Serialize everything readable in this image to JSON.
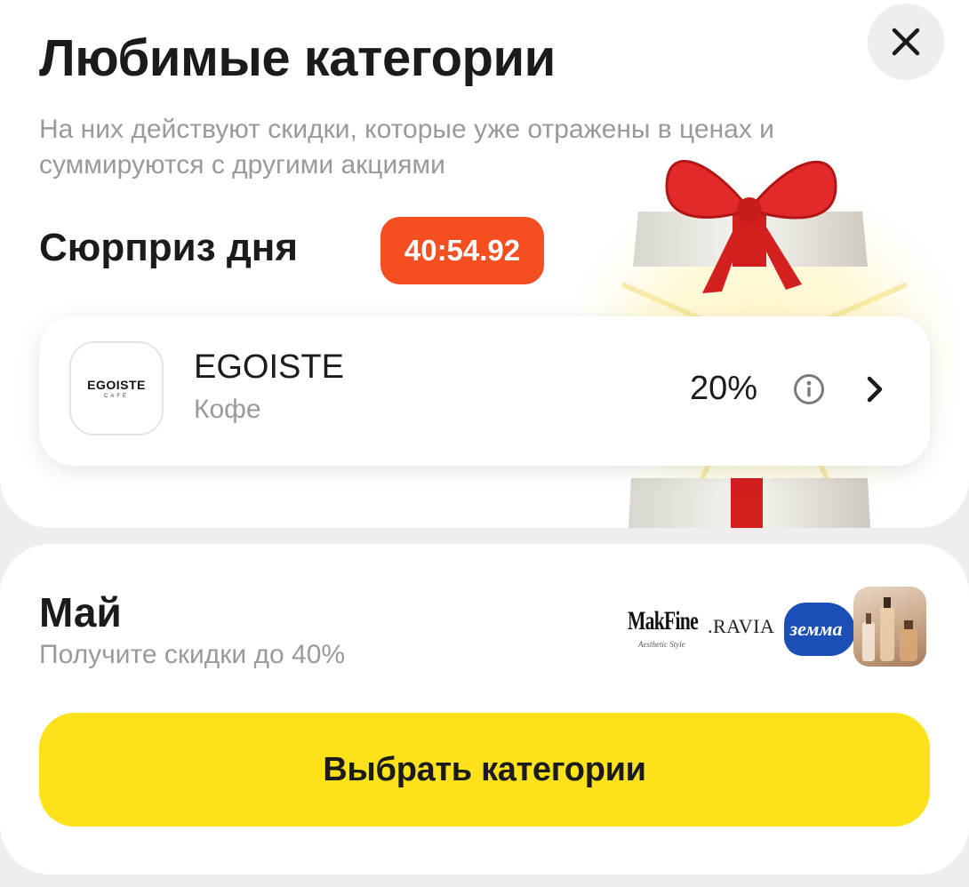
{
  "header": {
    "title": "Любимые категории",
    "subtitle": "На них действуют скидки, которые уже отражены в ценах и суммируются с другими акциями",
    "close_icon": "close-icon"
  },
  "surprise": {
    "title": "Сюрприз дня",
    "timer": "40:54.92",
    "illustration": "gift-box-with-red-bow",
    "colors": {
      "timer": "#f54e21",
      "bow": "#d41f1f"
    }
  },
  "brand_card": {
    "logo_text": "EGOISTE",
    "logo_subtext": "CAFÉ",
    "name": "EGOISTE",
    "category": "Кофе",
    "discount": "20%",
    "info_icon": "info-icon",
    "chevron_icon": "chevron-right-icon"
  },
  "month": {
    "title": "Май",
    "subtitle": "Получите скидки до 40%",
    "brand_logos": [
      {
        "text": "MakFine",
        "caption": "Aesthetic Style"
      },
      {
        "text": ".RAVIA"
      },
      {
        "text": "земма",
        "color": "#1a4fb6"
      },
      {
        "text": "",
        "image": "cosmetics-bottles"
      }
    ]
  },
  "cta": {
    "label": "Выбрать категории",
    "color": "#fde11a"
  }
}
